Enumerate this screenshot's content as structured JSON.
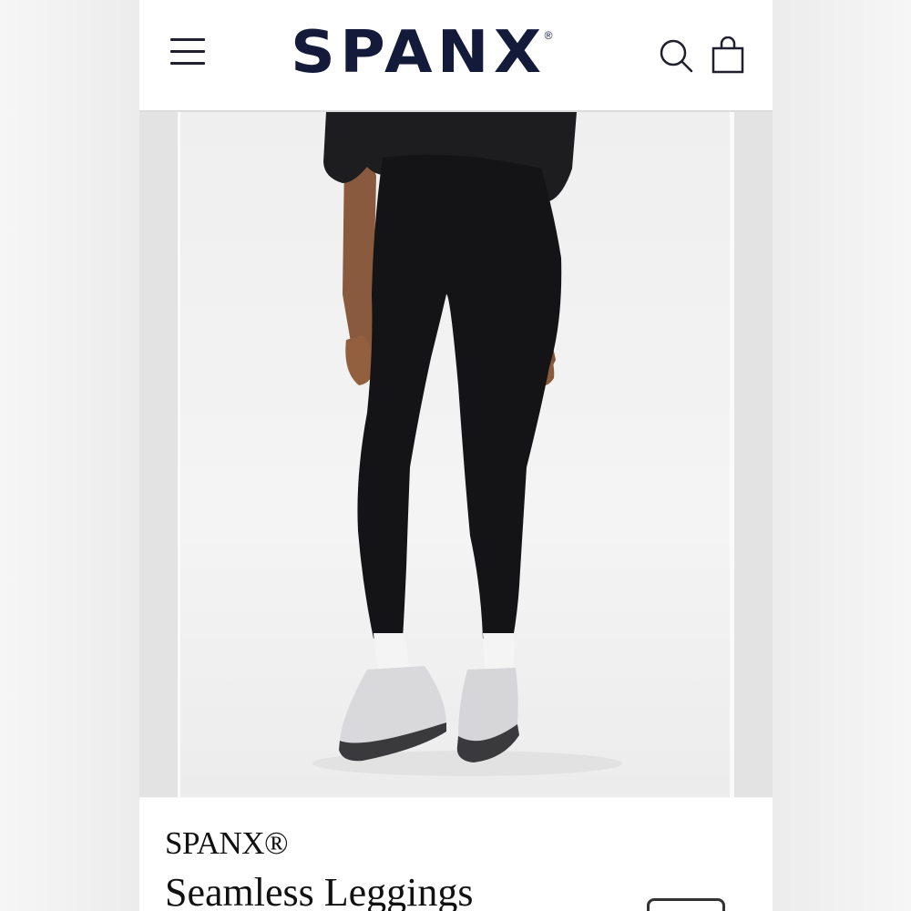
{
  "header": {
    "logo_text": "SPANX",
    "logo_mark": "®",
    "menu_icon": "hamburger-menu-icon",
    "search_icon": "search-icon",
    "cart_icon": "shopping-bag-icon",
    "brand_color": "#131a3a"
  },
  "gallery": {
    "image_alt": "Seamless Leggings"
  },
  "product": {
    "brand": "SPANX®",
    "title": "Seamless Leggings"
  }
}
